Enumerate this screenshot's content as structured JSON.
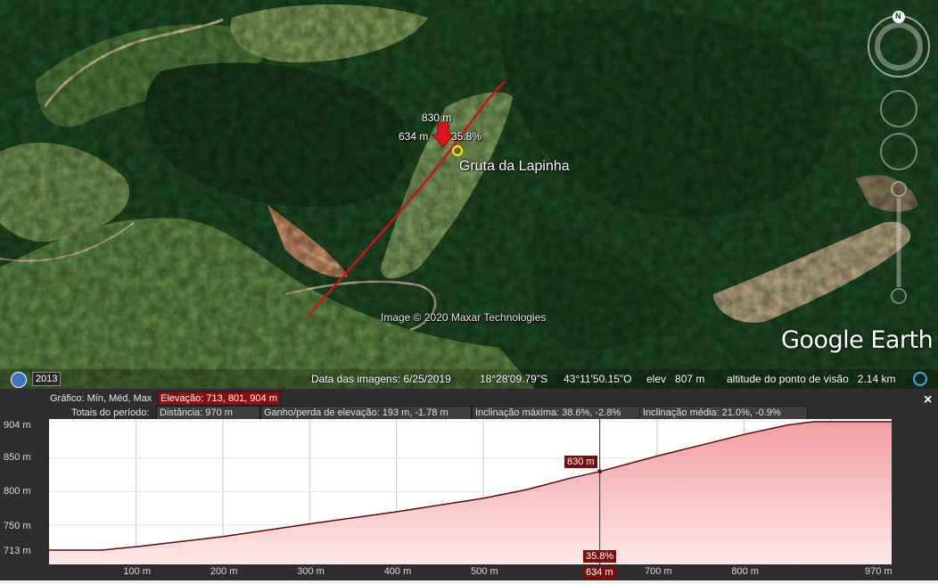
{
  "map": {
    "place_name": "Gruta da Lapinha",
    "marker_elev": "830 m",
    "marker_dist": "634 m",
    "marker_slope": "35.8%",
    "attribution": "Image © 2020 Maxar Technologies",
    "logo_google": "Google",
    "logo_earth": "Earth",
    "compass_label": "N",
    "year_button": "2013",
    "status": {
      "date": "Data das imagens: 6/25/2019",
      "lat": "18°28'09.79\"S",
      "lon": "43°11'50.15\"O",
      "elev": "elev   807 m",
      "viewpoint": "altitude do ponto de visão   2.14 km"
    }
  },
  "profile": {
    "header_graph": "Gráfico: Mín, Méd, Max",
    "elevation": "Elevação: 713, 801, 904 m",
    "header_totals": "Totais do período:",
    "distance": "Distância: 970 m",
    "gain_loss": "Ganho/perda de elevação: 193 m, -1.78 m",
    "max_slope": "Inclinação máxima: 38.6%, -2.8%",
    "avg_slope": "Inclinação média: 21.0%, -0.9%",
    "close_label": "×",
    "marker_elev_tag": "830 m",
    "marker_slope_tag": "35.8%",
    "marker_dist_tag": "634 m",
    "y_ticks": [
      "904 m",
      "850 m",
      "800 m",
      "750 m",
      "713 m"
    ],
    "x_ticks": [
      "100 m",
      "200 m",
      "300 m",
      "400 m",
      "500 m",
      "700 m",
      "800 m",
      "970 m"
    ]
  },
  "chart_data": {
    "type": "area",
    "xlabel": "",
    "ylabel": "",
    "xlim": [
      0,
      970
    ],
    "ylim": [
      713,
      904
    ],
    "x_unit": "m",
    "y_unit": "m",
    "fill_color": "#f6b8b8",
    "line_color": "#5a0a0a",
    "x": [
      0,
      60,
      100,
      200,
      300,
      400,
      500,
      550,
      600,
      634,
      700,
      800,
      850,
      880,
      970
    ],
    "y": [
      713,
      713,
      718,
      733,
      752,
      770,
      790,
      803,
      820,
      830,
      853,
      885,
      899,
      904,
      904
    ],
    "marker": {
      "x": 634,
      "y": 830,
      "slope": "35.8%"
    }
  }
}
